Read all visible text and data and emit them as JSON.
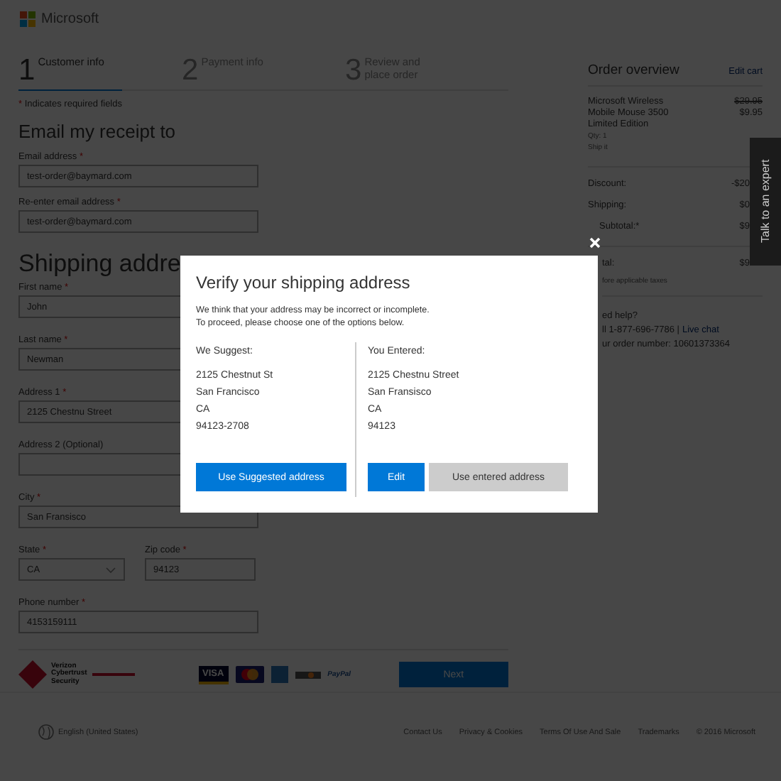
{
  "header": {
    "logo_text": "Microsoft"
  },
  "steps": [
    {
      "number": "1",
      "label": "Customer info",
      "selected": true
    },
    {
      "number": "2",
      "label": "Payment info",
      "selected": false
    },
    {
      "number": "3",
      "label": "Review and place order",
      "selected": false
    }
  ],
  "required_note": {
    "mark": "*",
    "text": "Indicates required fields"
  },
  "email": {
    "heading": "Email my receipt to",
    "fields": [
      {
        "label": "Email address",
        "mark": "*",
        "value": "test-order@baymard.com",
        "kind": "text"
      },
      {
        "label": "Re-enter email address",
        "mark": "*",
        "value": "test-order@baymard.com",
        "kind": "text"
      }
    ]
  },
  "shipping": {
    "heading": "Shipping addre",
    "rows": [
      [
        {
          "label": "First name",
          "mark": "*",
          "value": "John",
          "kind": "text"
        }
      ],
      [
        {
          "label": "Last name",
          "mark": "*",
          "value": "Newman",
          "kind": "text"
        }
      ],
      [
        {
          "label": "Address 1",
          "mark": "*",
          "value": "2125 Chestnu Street",
          "kind": "text"
        }
      ],
      [
        {
          "label": "Address 2 (Optional)",
          "kind": "text"
        }
      ],
      [
        {
          "label": "City",
          "mark": "*",
          "value": "San Fransisco",
          "kind": "text"
        }
      ],
      [
        {
          "label": "State",
          "mark": "*",
          "value": "CA",
          "kind": "select"
        },
        {
          "label": "Zip code",
          "mark": "*",
          "value": "94123",
          "kind": "text"
        }
      ],
      [
        {
          "label": "Phone number",
          "mark": "*",
          "value": "4153159111",
          "kind": "text"
        }
      ]
    ]
  },
  "trust_bar": {
    "seal_text": "Verizon Cybertrust Security",
    "cards": [
      {
        "kind": "visa",
        "label": "VISA"
      },
      {
        "kind": "mastercard"
      },
      {
        "kind": "amex"
      },
      {
        "kind": "discover"
      },
      {
        "kind": "paypal",
        "label": "PayPal"
      }
    ],
    "next_button": "Next"
  },
  "order": {
    "title": "Order overview",
    "edit_link": "Edit cart",
    "item": {
      "name": "Microsoft Wireless Mobile Mouse 3500 Limited Edition",
      "old_price": "$29.95",
      "price": "$9.95",
      "qty": "Qty: 1",
      "shipping": "Ship it"
    },
    "lines": [
      {
        "label": "Discount:",
        "value": "-$20"
      },
      {
        "label": "Shipping:",
        "value": "$0"
      },
      {
        "label": "Subtotal:*",
        "value": "$9"
      }
    ],
    "total": {
      "label": "tal:",
      "value": "$9"
    },
    "tax_note": "fore applicable taxes",
    "help": {
      "heading": "ed help?",
      "phone": "ll 1-877-696-7786 |",
      "chat_link": "Live chat",
      "order_number": "ur order number: 10601373364"
    }
  },
  "talk_tab": "Talk to an expert",
  "footer": {
    "locale": "English (United States)",
    "links": [
      "Contact Us",
      "Privacy & Cookies",
      "Terms Of Use And Sale",
      "Trademarks"
    ],
    "copyright": "© 2016 Microsoft"
  },
  "dialog": {
    "title": "Verify your shipping address",
    "message": [
      "We think that your address may be incorrect or incomplete.",
      "To proceed, please choose one of the options below."
    ],
    "columns": [
      {
        "heading": "We Suggest:",
        "lines": [
          "2125 Chestnut St",
          "San Francisco",
          "CA",
          "94123-2708"
        ],
        "buttons": [
          {
            "label": "Use Suggested address",
            "kind": "primary"
          }
        ]
      },
      {
        "heading": "You Entered:",
        "lines": [
          "2125 Chestnu Street",
          "San Fransisco",
          "CA",
          "94123"
        ],
        "buttons": [
          {
            "label": "Edit",
            "kind": "primary"
          },
          {
            "label": "Use entered address",
            "kind": "secondary"
          }
        ]
      }
    ]
  }
}
